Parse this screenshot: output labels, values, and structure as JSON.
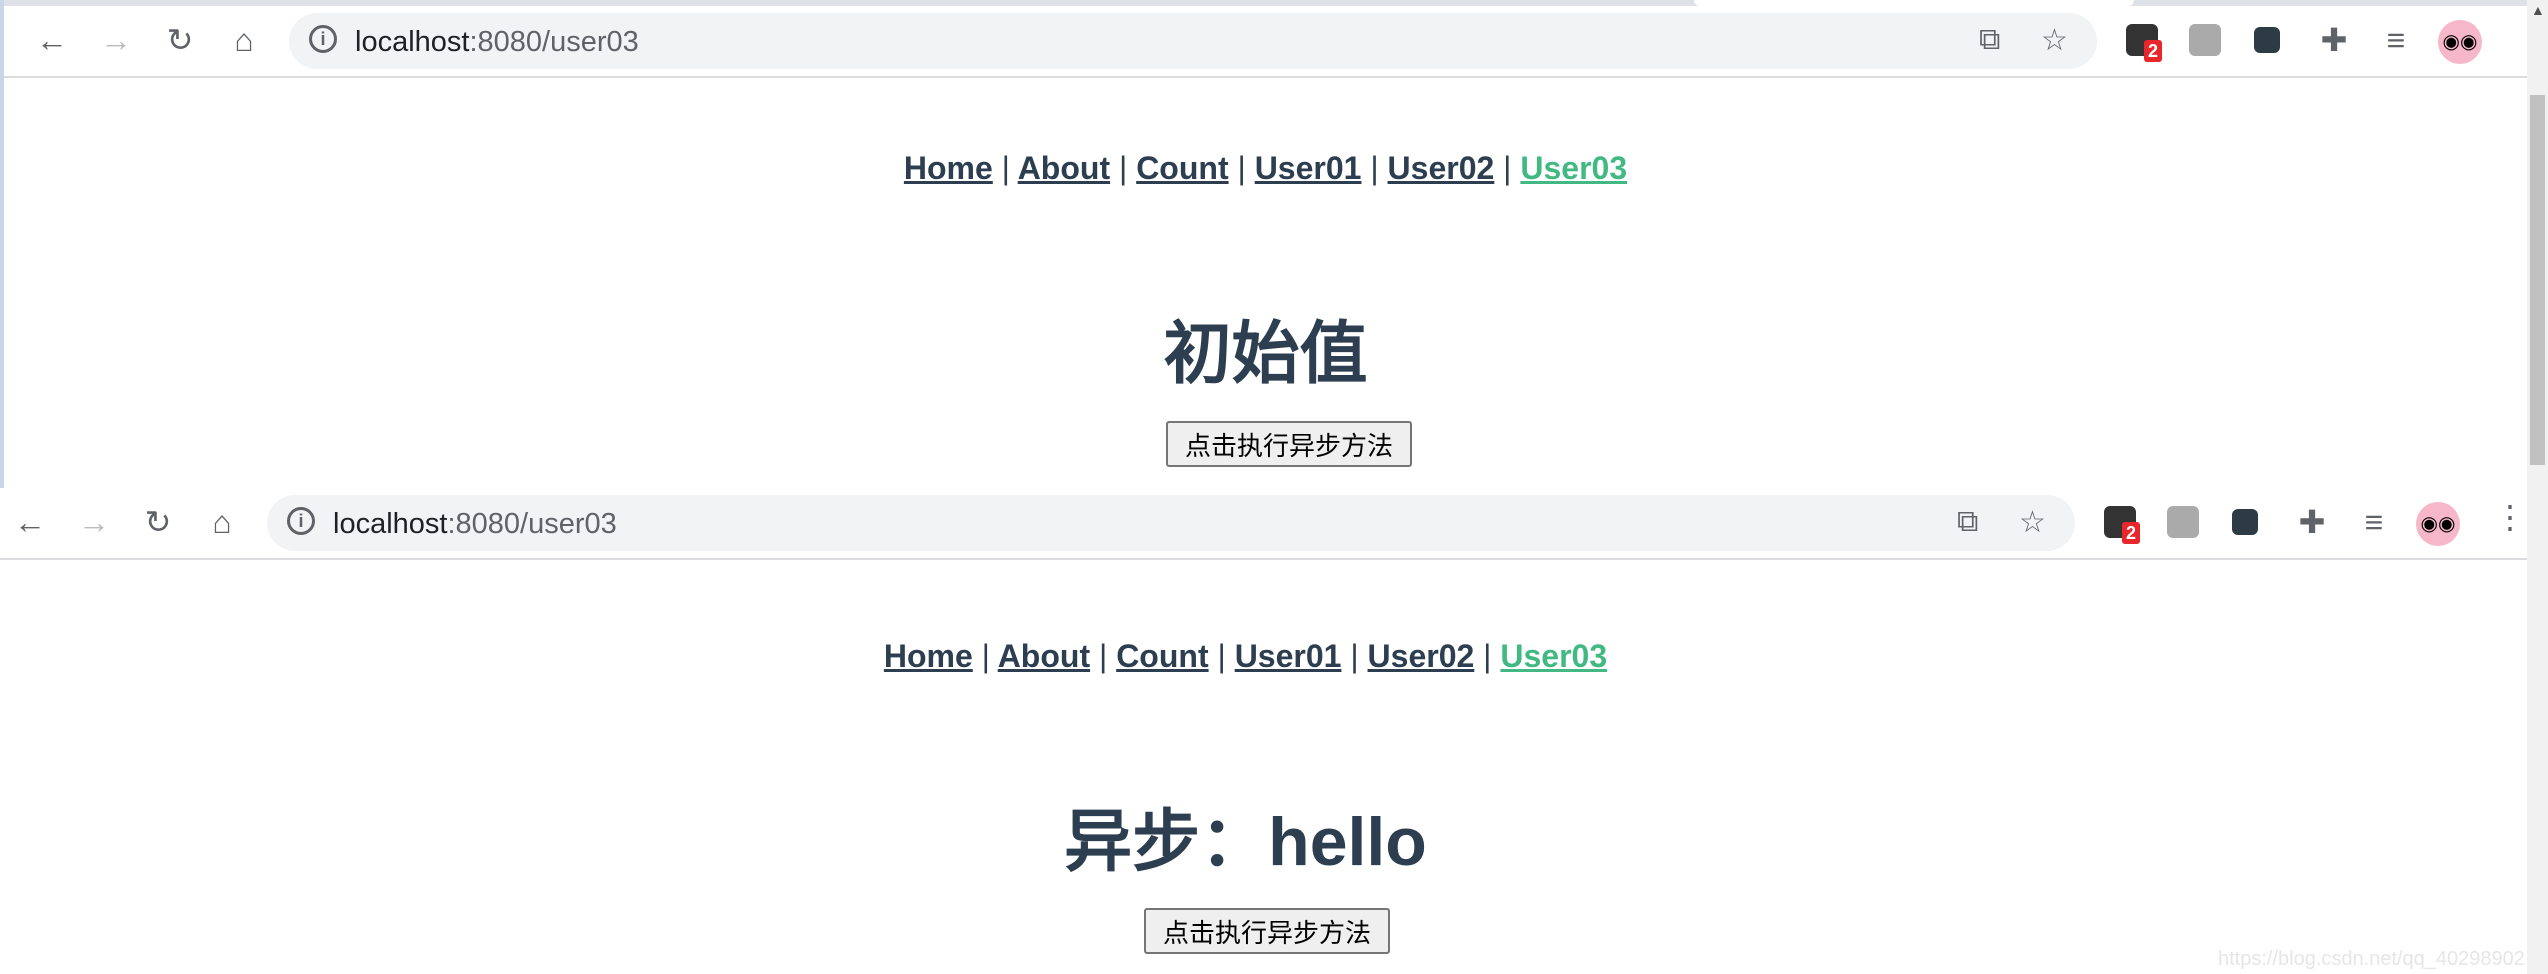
{
  "browser": {
    "url_host": "localhost",
    "url_rest": ":8080/user03",
    "extension_badge": "2"
  },
  "nav": {
    "items": [
      {
        "label": "Home"
      },
      {
        "label": "About"
      },
      {
        "label": "Count"
      },
      {
        "label": "User01"
      },
      {
        "label": "User02"
      },
      {
        "label": "User03",
        "active": true
      }
    ],
    "separator": "|",
    "active_color": "#42b983",
    "text_color": "#2c3e50"
  },
  "before": {
    "heading": "初始值",
    "button_label": "点击执行异步方法"
  },
  "after": {
    "heading": "异步：hello",
    "button_label": "点击执行异步方法"
  },
  "watermark": "https://blog.csdn.net/qq_40298902"
}
